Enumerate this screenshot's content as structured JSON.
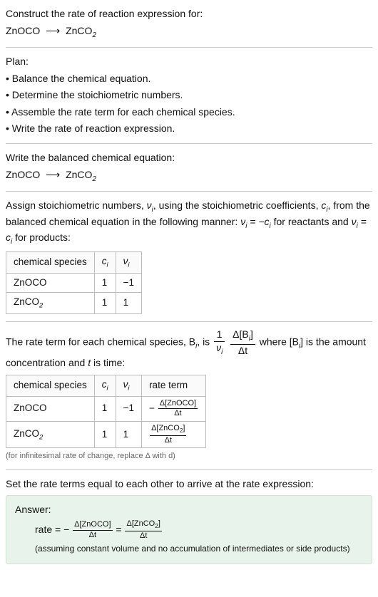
{
  "title": "Construct the rate of reaction expression for:",
  "equation_simple": {
    "lhs": "ZnOCO",
    "rhs": "ZnCO",
    "rhs_sub": "2"
  },
  "plan_heading": "Plan:",
  "plan": [
    "Balance the chemical equation.",
    "Determine the stoichiometric numbers.",
    "Assemble the rate term for each chemical species.",
    "Write the rate of reaction expression."
  ],
  "balance_heading": "Write the balanced chemical equation:",
  "stoich_text_1": "Assign stoichiometric numbers, ",
  "stoich_nu": "ν",
  "stoich_text_2": ", using the stoichiometric coefficients, ",
  "stoich_c": "c",
  "stoich_text_3": ", from the balanced chemical equation in the following manner: ",
  "stoich_rel_1a": "ν",
  "stoich_rel_1b": " = −c",
  "stoich_text_4": " for reactants and ",
  "stoich_rel_2a": "ν",
  "stoich_rel_2b": " = c",
  "stoich_text_5": " for products:",
  "headers": {
    "species": "chemical species",
    "ci": "c",
    "nui": "ν",
    "rate_term": "rate term"
  },
  "row1": {
    "species": "ZnOCO",
    "ci": "1",
    "nui": "−1"
  },
  "row2": {
    "species": "ZnCO",
    "species_sub": "2",
    "ci": "1",
    "nui": "1"
  },
  "rate_sentence_1": "The rate term for each chemical species, B",
  "rate_sentence_2": ", is ",
  "rate_sentence_3": " where [B",
  "rate_sentence_4": "] is the amount concentration and ",
  "rate_sentence_t": "t",
  "rate_sentence_5": " is time:",
  "frac1_num": "1",
  "frac1_den": "ν",
  "frac2_num": "Δ[B",
  "frac2_num_end": "]",
  "frac2_den": "Δt",
  "rt_row1_num": "Δ[ZnOCO]",
  "rt_row1_den": "Δt",
  "rt_row2_num_a": "Δ[ZnCO",
  "rt_row2_num_b": "]",
  "rt_row2_den": "Δt",
  "inf_note": "(for infinitesimal rate of change, replace Δ with d)",
  "final_sentence": "Set the rate terms equal to each other to arrive at the rate expression:",
  "answer_label": "Answer:",
  "answer_rate": "rate = −",
  "answer_eq": " = ",
  "answer_assump": "(assuming constant volume and no accumulation of intermediates or side products)",
  "i": "i",
  "minus": "−",
  "bullet": "•"
}
